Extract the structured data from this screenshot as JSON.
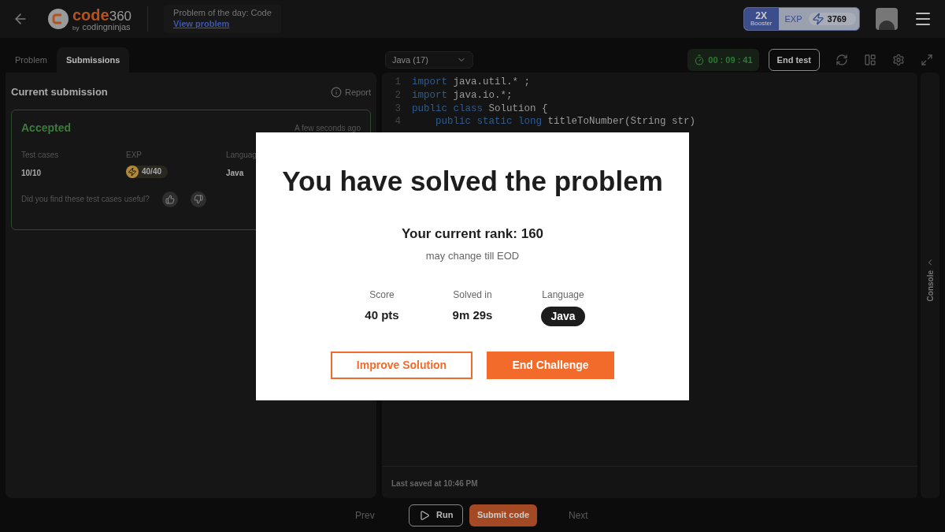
{
  "header": {
    "logo_main": "code",
    "logo_num": "360",
    "logo_by": "by",
    "logo_brand": "codingninjas",
    "potd_label": "Problem of the day: Code",
    "potd_link": "View problem",
    "booster_x": "2X",
    "booster_label": "Booster",
    "exp_label": "EXP",
    "exp_value": "3769"
  },
  "left_tabs": [
    {
      "label": "Problem",
      "selected": false
    },
    {
      "label": "Submissions",
      "selected": true
    }
  ],
  "submission": {
    "title": "Current submission",
    "report": "Report",
    "status": "Accepted",
    "time": "A few seconds ago",
    "test_cases_label": "Test cases",
    "test_cases": "10/10",
    "exp_label": "EXP",
    "exp": "40/40",
    "language_label": "Languag",
    "language": "Java",
    "feedback": "Did you find these test cases useful?"
  },
  "editor": {
    "language": "Java (17)",
    "timer": "00 : 09 : 41",
    "end_test": "End test",
    "lines": [
      {
        "num": "1",
        "code": [
          {
            "t": "import",
            "kw": true
          },
          {
            "t": " java.util.* ;",
            "kw": false
          }
        ]
      },
      {
        "num": "2",
        "code": [
          {
            "t": "import",
            "kw": true
          },
          {
            "t": " java.io.*;",
            "kw": false
          }
        ]
      },
      {
        "num": "3",
        "code": [
          {
            "t": "public class",
            "kw": true
          },
          {
            "t": " Solution {",
            "kw": false
          }
        ]
      },
      {
        "num": "4",
        "code": [
          {
            "t": "    public static long",
            "kw": true
          },
          {
            "t": " titleToNumber(String str)",
            "kw": false
          }
        ]
      }
    ],
    "last_saved": "Last saved at 10:46 PM",
    "console": "Console"
  },
  "bottom": {
    "prev": "Prev",
    "run": "Run",
    "submit": "Submit code",
    "next": "Next"
  },
  "modal": {
    "title": "You have solved the problem",
    "rank": "Your current rank: 160",
    "rank_note": "may change till EOD",
    "stats": [
      {
        "label": "Score",
        "value": "40 pts",
        "kind": "text"
      },
      {
        "label": "Solved in",
        "value": "9m 29s",
        "kind": "text"
      },
      {
        "label": "Language",
        "value": "Java",
        "kind": "pill"
      }
    ],
    "improve": "Improve Solution",
    "end": "End Challenge"
  }
}
